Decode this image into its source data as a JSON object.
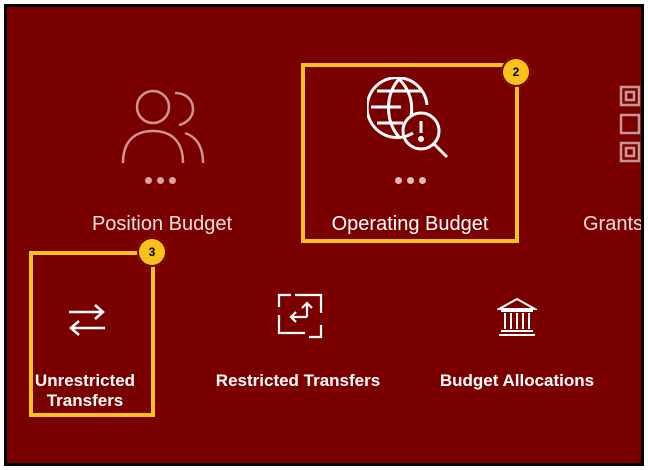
{
  "tiles": {
    "position_budget": {
      "label": "Position Budget"
    },
    "operating_budget": {
      "label": "Operating Budget"
    },
    "grants": {
      "label": "Grants"
    },
    "unrestricted_transfers": {
      "label_line1": "Unrestricted",
      "label_line2": "Transfers"
    },
    "restricted_transfers": {
      "label": "Restricted Transfers"
    },
    "budget_allocations": {
      "label": "Budget Allocations"
    }
  },
  "callouts": {
    "operating_budget_step": "2",
    "unrestricted_transfers_step": "3"
  },
  "colors": {
    "background": "#7a0000",
    "highlight": "#f7c21b",
    "icon": "#ffffff",
    "dots": "#d9a3a3"
  },
  "icons": {
    "position_budget": "users-icon",
    "operating_budget": "globe-search-alert-icon",
    "grants": "grid-icon",
    "unrestricted_transfers": "swap-arrows-icon",
    "restricted_transfers": "bounded-swap-arrows-icon",
    "budget_allocations": "bank-building-icon"
  }
}
